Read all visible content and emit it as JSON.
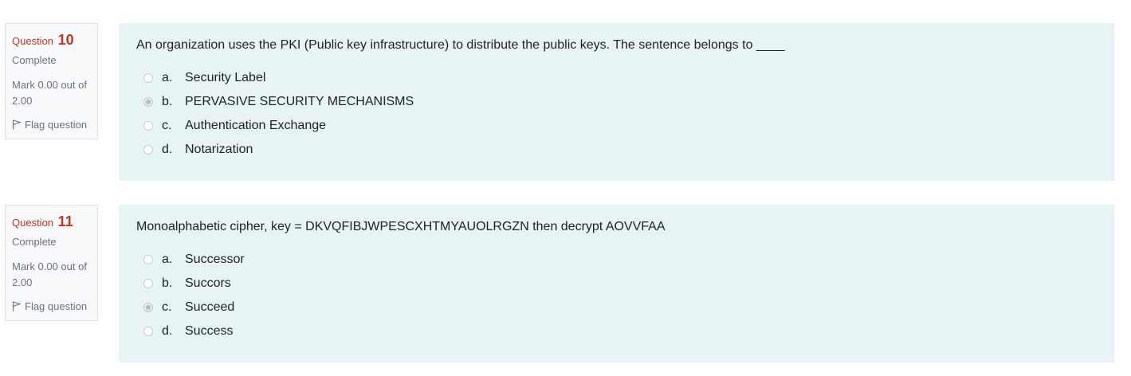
{
  "questions": [
    {
      "number_prefix": "Question",
      "number": "10",
      "state": "Complete",
      "grade": "Mark 0.00 out of 2.00",
      "flag_label": "Flag question",
      "text": "An organization uses the PKI (Public key infrastructure) to distribute the public keys. The sentence belongs to ____",
      "answers": [
        {
          "letter": "a.",
          "label": "Security Label",
          "selected": false
        },
        {
          "letter": "b.",
          "label": "PERVASIVE SECURITY MECHANISMS",
          "selected": true
        },
        {
          "letter": "c.",
          "label": "Authentication Exchange",
          "selected": false
        },
        {
          "letter": "d.",
          "label": "Notarization",
          "selected": false
        }
      ]
    },
    {
      "number_prefix": "Question",
      "number": "11",
      "state": "Complete",
      "grade": "Mark 0.00 out of 2.00",
      "flag_label": "Flag question",
      "text": "Monoalphabetic cipher, key = DKVQFIBJWPESCXHTMYAUOLRGZN then decrypt AOVVFAA",
      "answers": [
        {
          "letter": "a.",
          "label": "Successor",
          "selected": false
        },
        {
          "letter": "b.",
          "label": "Succors",
          "selected": false
        },
        {
          "letter": "c.",
          "label": "Succeed",
          "selected": true
        },
        {
          "letter": "d.",
          "label": "Success",
          "selected": false
        }
      ]
    }
  ],
  "colors": {
    "accent": "#ca3120",
    "content_bg": "#e7f3f5",
    "info_bg": "#f8f9fa"
  }
}
